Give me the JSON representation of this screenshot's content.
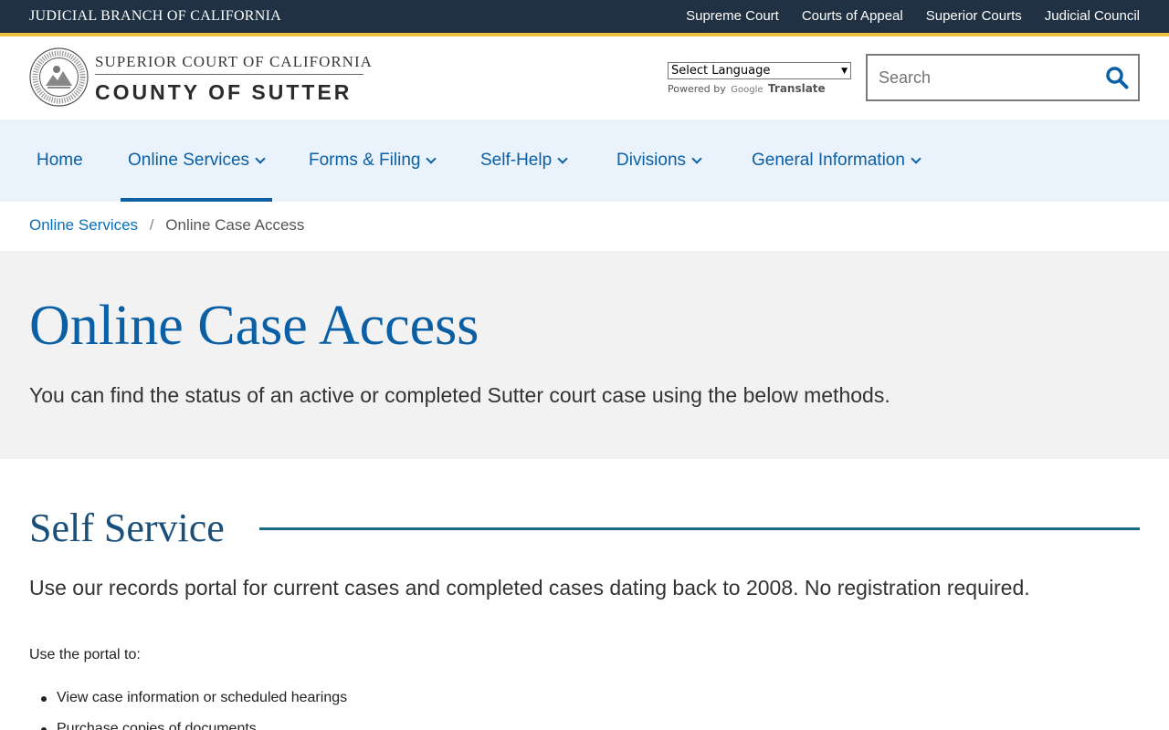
{
  "topbar": {
    "brand": "JUDICIAL BRANCH OF CALIFORNIA",
    "links": [
      "Supreme Court",
      "Courts of Appeal",
      "Superior Courts",
      "Judicial Council"
    ]
  },
  "header": {
    "court_name": "SUPERIOR COURT OF CALIFORNIA",
    "county_name": "COUNTY OF SUTTER",
    "translate": {
      "select_label": "Select Language",
      "powered_by": "Powered by",
      "google": "Google",
      "translate": "Translate"
    },
    "search": {
      "placeholder": "Search"
    }
  },
  "nav": {
    "items": [
      {
        "label": "Home"
      },
      {
        "label": "Online Services"
      },
      {
        "label": "Forms & Filing"
      },
      {
        "label": "Self-Help"
      },
      {
        "label": "Divisions"
      },
      {
        "label": "General Information"
      }
    ],
    "active": "Online Services"
  },
  "breadcrumb": {
    "parent": "Online Services",
    "separator": "/",
    "current": "Online Case Access"
  },
  "hero": {
    "title": "Online Case Access",
    "intro": "You can find the status of an active or completed Sutter court case using the below methods."
  },
  "section": {
    "title": "Self Service",
    "lead": "Use our records portal for current cases and completed cases dating back to 2008. No registration required.",
    "list_intro": "Use the portal to:",
    "bullets": [
      "View case information or scheduled hearings",
      "Purchase copies of documents"
    ]
  },
  "colors": {
    "topbar": "#1f3143",
    "accent": "#f0c040",
    "link_blue": "#0b5fa5",
    "nav_bg": "#eaf3fb",
    "hero_bg": "#f2f2f2",
    "section_rule": "#1b6a83"
  },
  "icons": {
    "search": "search-icon",
    "seal": "court-seal-icon",
    "chevron": "chevron-down-icon"
  }
}
